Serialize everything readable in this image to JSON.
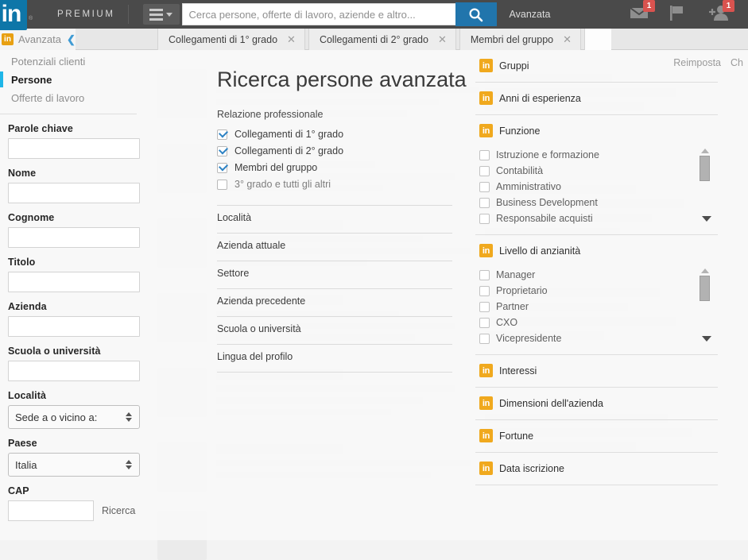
{
  "header": {
    "logo_text": "in",
    "logo_registered": "®",
    "premium_label": "PREMIUM",
    "category_icon": "hamburger-dropdown-icon",
    "search": {
      "placeholder": "Cerca persone, offerte di lavoro, aziende e altro...",
      "value": "",
      "button_icon": "search-icon"
    },
    "advanced_link": "Avanzata",
    "icons": [
      {
        "name": "inbox-icon",
        "badge": "1"
      },
      {
        "name": "flag-icon",
        "badge": ""
      },
      {
        "name": "add-connection-icon",
        "badge": "1"
      }
    ],
    "colors": {
      "bar": "#4a4a4a",
      "logo_blue": "#0e76a8",
      "search_button": "#2175ac",
      "badge_red": "#d9534f"
    }
  },
  "tabstrip": {
    "mini_logo": "in",
    "mini_label": "Avanzata",
    "collapse_icon": "chevron-left-icon",
    "tabs": [
      {
        "label": "Collegamenti di 1° grado",
        "close_icon": "close-icon"
      },
      {
        "label": "Collegamenti di 2° grado",
        "close_icon": "close-icon"
      },
      {
        "label": "Membri del gruppo",
        "close_icon": "close-icon"
      }
    ]
  },
  "panel_actions": {
    "reset": "Reimposta",
    "close": "Ch"
  },
  "sidebar": {
    "nav": [
      {
        "label": "Potenziali clienti",
        "active": false
      },
      {
        "label": "Persone",
        "active": true
      },
      {
        "label": "Offerte di lavoro",
        "active": false
      }
    ],
    "fields": [
      {
        "label": "Parole chiave",
        "value": "",
        "placeholder": "",
        "type": "text"
      },
      {
        "label": "Nome",
        "value": "",
        "placeholder": "",
        "type": "text"
      },
      {
        "label": "Cognome",
        "value": "",
        "placeholder": "",
        "type": "text"
      },
      {
        "label": "Titolo",
        "value": "",
        "placeholder": "",
        "type": "text"
      },
      {
        "label": "Azienda",
        "value": "",
        "placeholder": "",
        "type": "text"
      },
      {
        "label": "Scuola o università",
        "value": "",
        "placeholder": "",
        "type": "text"
      }
    ],
    "locality": {
      "label": "Località",
      "value": "Sede a o vicino a:"
    },
    "country": {
      "label": "Paese",
      "value": "Italia"
    },
    "cap": {
      "label": "CAP",
      "value": "",
      "search_label": "Ricerca"
    },
    "active_indicator_color": "#1fb6e8"
  },
  "main": {
    "title": "Ricerca persone avanzata",
    "relationship_group_label": "Relazione professionale",
    "relationship_options": [
      {
        "label": "Collegamenti di 1° grado",
        "checked": true
      },
      {
        "label": "Collegamenti di 2° grado",
        "checked": true
      },
      {
        "label": "Membri del gruppo",
        "checked": true
      },
      {
        "label": "3° grado e tutti gli altri",
        "checked": false
      }
    ],
    "filter_sections": [
      "Località",
      "Azienda attuale",
      "Settore",
      "Azienda precedente",
      "Scuola o università",
      "Lingua del profilo"
    ]
  },
  "premium": {
    "badge_text": "in",
    "badge_color": "#f0a91e",
    "sections": [
      {
        "title": "Gruppi",
        "options": [],
        "expanded": false
      },
      {
        "title": "Anni di esperienza",
        "options": [],
        "expanded": false
      },
      {
        "title": "Funzione",
        "expanded": true,
        "options": [
          {
            "label": "Istruzione e formazione",
            "checked": false
          },
          {
            "label": "Contabilità",
            "checked": false
          },
          {
            "label": "Amministrativo",
            "checked": false
          },
          {
            "label": "Business Development",
            "checked": false
          },
          {
            "label": "Responsabile acquisti",
            "checked": false
          }
        ]
      },
      {
        "title": "Livello di anzianità",
        "expanded": true,
        "options": [
          {
            "label": "Manager",
            "checked": false
          },
          {
            "label": "Proprietario",
            "checked": false
          },
          {
            "label": "Partner",
            "checked": false
          },
          {
            "label": "CXO",
            "checked": false
          },
          {
            "label": "Vicepresidente",
            "checked": false
          }
        ]
      },
      {
        "title": "Interessi",
        "options": [],
        "expanded": false
      },
      {
        "title": "Dimensioni dell'azienda",
        "options": [],
        "expanded": false
      },
      {
        "title": "Fortune",
        "options": [],
        "expanded": false
      },
      {
        "title": "Data iscrizione",
        "options": [],
        "expanded": false
      }
    ]
  }
}
